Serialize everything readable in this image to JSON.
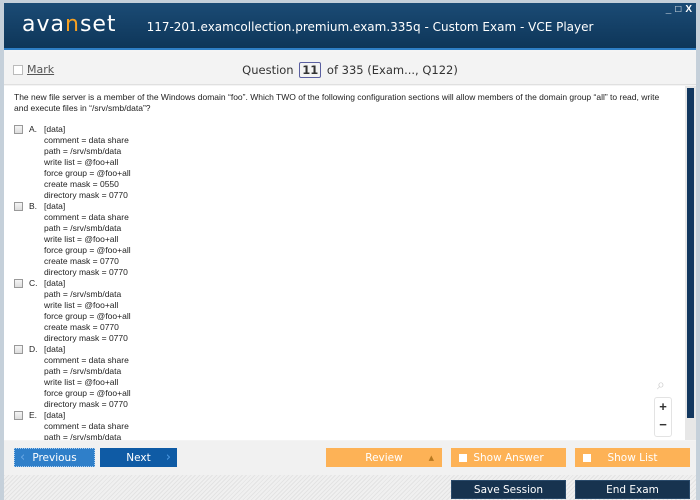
{
  "window": {
    "logo_prefix": "ava",
    "logo_accent": "n",
    "logo_suffix": "set",
    "title": "117-201.examcollection.premium.exam.335q - Custom Exam - VCE Player",
    "controls": {
      "minimize": "_",
      "maximize": "□",
      "close": "X"
    }
  },
  "header": {
    "mark_label": "Mark",
    "question_label": "Question",
    "question_number": "11",
    "of_text": "of 335 (Exam..., Q122)"
  },
  "question": {
    "text": "The new file server is a member of the Windows domain “foo”. Which TWO of the following configuration sections will allow members of the domain group “all” to read, write and execute files in “/srv/smb/data”?",
    "options": [
      {
        "letter": "A.",
        "lines": [
          "[data]",
          "comment = data share",
          "path = /srv/smb/data",
          "write list = @foo+all",
          "force group = @foo+all",
          "create mask = 0550",
          "directory mask = 0770"
        ]
      },
      {
        "letter": "B.",
        "lines": [
          "[data]",
          "comment = data share",
          "path = /srv/smb/data",
          "write list = @foo+all",
          "force group = @foo+all",
          "create mask = 0770",
          "directory mask = 0770"
        ]
      },
      {
        "letter": "C.",
        "lines": [
          "[data]",
          "path = /srv/smb/data",
          "write list = @foo+all",
          "force group = @foo+all",
          "create mask = 0770",
          "directory mask = 0770"
        ]
      },
      {
        "letter": "D.",
        "lines": [
          "[data]",
          "comment = data share",
          "path = /srv/smb/data",
          "write list = @foo+all",
          "force group = @foo+all",
          "directory mask = 0770"
        ]
      },
      {
        "letter": "E.",
        "lines": [
          "[data]",
          "comment = data share",
          "path = /srv/smb/data"
        ]
      }
    ]
  },
  "zoom": {
    "magnifier_icon": "search-icon",
    "plus": "+",
    "minus": "−"
  },
  "toolbar": {
    "previous_label": "Previous",
    "next_label": "Next",
    "review_label": "Review",
    "show_answer_label": "Show Answer",
    "show_list_label": "Show List"
  },
  "footer": {
    "save_session_label": "Save Session",
    "end_exam_label": "End Exam"
  },
  "colors": {
    "titlebar": "#0e3659",
    "logo_accent": "#f7a021",
    "nav_button": "#0f5ba5",
    "orange_button": "#fdb256",
    "dark_button": "#17334f"
  }
}
